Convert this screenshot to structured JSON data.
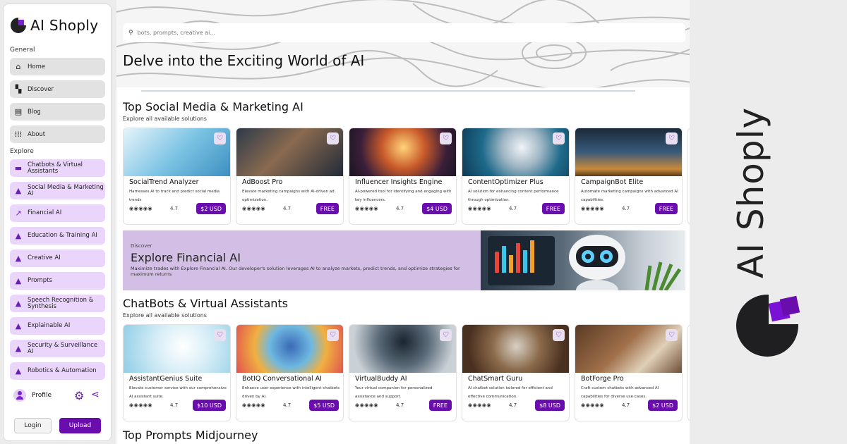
{
  "app": {
    "name": "AI Shoply"
  },
  "sidebar": {
    "general_label": "General",
    "explore_label": "Explore",
    "general_items": [
      {
        "label": "Home",
        "icon": "home-icon"
      },
      {
        "label": "Discover",
        "icon": "dashboard-icon"
      },
      {
        "label": "Blog",
        "icon": "newspaper-icon"
      },
      {
        "label": "About",
        "icon": "grid-dots-icon"
      }
    ],
    "explore_items": [
      {
        "label": "Chatbots & Virtual Assistants",
        "icon": "chat-icon"
      },
      {
        "label": "Social Media & Marketing AI",
        "icon": "shapes-icon"
      },
      {
        "label": "Financial AI",
        "icon": "trending-up-icon"
      },
      {
        "label": "Education & Training AI",
        "icon": "shapes-icon"
      },
      {
        "label": "Creative AI",
        "icon": "shapes-icon"
      },
      {
        "label": "Prompts",
        "icon": "shapes-icon"
      },
      {
        "label": "Speech Recognition & Synthesis",
        "icon": "shapes-icon"
      },
      {
        "label": "Explainable AI",
        "icon": "shapes-icon"
      },
      {
        "label": "Security & Surveillance AI",
        "icon": "shapes-icon"
      },
      {
        "label": "Robotics & Automation",
        "icon": "shapes-icon"
      }
    ],
    "profile_label": "Profile",
    "login_label": "Login",
    "upload_label": "Upload"
  },
  "search": {
    "placeholder": "bots, prompts, creative ai..."
  },
  "hero": {
    "title": "Delve into the Exciting World of AI"
  },
  "sections": [
    {
      "title": "Top Social Media & Marketing AI",
      "subtitle": "Explore all available solutions",
      "cards": [
        {
          "name": "SocialTrend Analyzer",
          "desc": "Harnesses AI to track and predict social media trends",
          "rating": "4.7",
          "price": "$2 USD"
        },
        {
          "name": "AdBoost Pro",
          "desc": "Elevate marketing campaigns with AI-driven ad optimization.",
          "rating": "4.7",
          "price": "FREE"
        },
        {
          "name": "Influencer Insights Engine",
          "desc": "AI-powered tool for identifying and engaging with key influencers.",
          "rating": "4.7",
          "price": "$4 USD"
        },
        {
          "name": "ContentOptimizer Plus",
          "desc": "AI solution for enhancing content performance through optimization.",
          "rating": "4.7",
          "price": "FREE"
        },
        {
          "name": "CampaignBot Elite",
          "desc": "Automate marketing campaigns with advanced AI capabilities.",
          "rating": "4.7",
          "price": "FREE"
        }
      ]
    },
    {
      "title": "ChatBots & Virtual Assistants",
      "subtitle": "Explore all available solutions",
      "cards": [
        {
          "name": "AssistantGenius Suite",
          "desc": "Elevate customer service with our comprehensive AI assistant suite.",
          "rating": "4.7",
          "price": "$10 USD"
        },
        {
          "name": "BotIQ Conversational AI",
          "desc": "Enhance user experience with intelligent chatbots driven by AI.",
          "rating": "4.7",
          "price": "$5 USD"
        },
        {
          "name": "VirtualBuddy AI",
          "desc": "Your virtual companion for personalized assistance and support.",
          "rating": "4.7",
          "price": "FREE"
        },
        {
          "name": "ChatSmart Guru",
          "desc": "AI chatbot solution tailored for efficient and effective communication.",
          "rating": "4.7",
          "price": "$8 USD"
        },
        {
          "name": "BotForge Pro",
          "desc": "Craft custom chatbots with advanced AI capabilities for diverse use cases.",
          "rating": "4.7",
          "price": "$2 USD"
        }
      ]
    }
  ],
  "banner": {
    "kicker": "Discover",
    "title": "Explore Financial AI",
    "text": "Maximize trades with Explore Financial AI. Our developer's solution leverages AI to analyze markets, predict trends, and optimize strategies for maximum returns"
  },
  "next_section_title": "Top Prompts Midjourney",
  "right_panel": {
    "brand_text": "AI Shoply"
  },
  "colors": {
    "accent": "#6a0dad",
    "explore_bg": "#ead6fb",
    "banner_bg": "#d3bfe6"
  }
}
